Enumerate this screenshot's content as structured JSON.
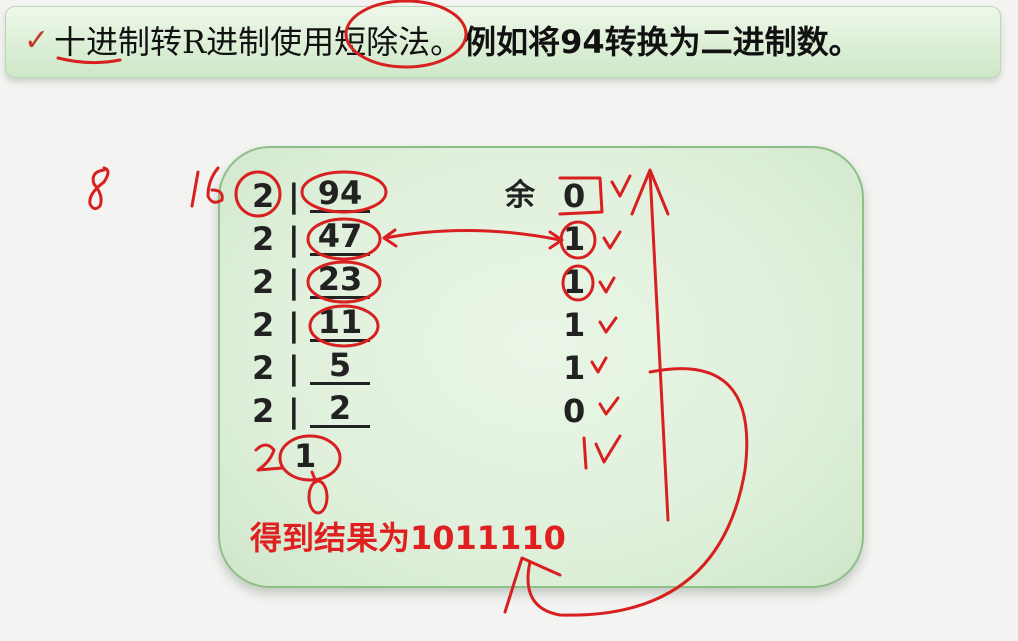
{
  "header": {
    "check_mark": "✓",
    "plain_text": "十进制转R进制使用短除法。",
    "bold_text": "例如将94转换为二进制数。"
  },
  "division": {
    "rows": [
      {
        "divisor": "2",
        "bar": "|",
        "dividend": "94",
        "remainder": "0"
      },
      {
        "divisor": "2",
        "bar": "|",
        "dividend": "47",
        "remainder": "1"
      },
      {
        "divisor": "2",
        "bar": "|",
        "dividend": "23",
        "remainder": "1"
      },
      {
        "divisor": "2",
        "bar": "|",
        "dividend": "11",
        "remainder": "1"
      },
      {
        "divisor": "2",
        "bar": "|",
        "dividend": "5",
        "remainder": "1"
      },
      {
        "divisor": "2",
        "bar": "|",
        "dividend": "2",
        "remainder": "0"
      }
    ],
    "last_quotient": "1",
    "remainder_label": "余"
  },
  "result_text": "得到结果为1011110",
  "handwriting": {
    "base_8": "8",
    "base_16": "16",
    "extra_divisor": "2",
    "extra_zero": "0",
    "check": "✓"
  }
}
